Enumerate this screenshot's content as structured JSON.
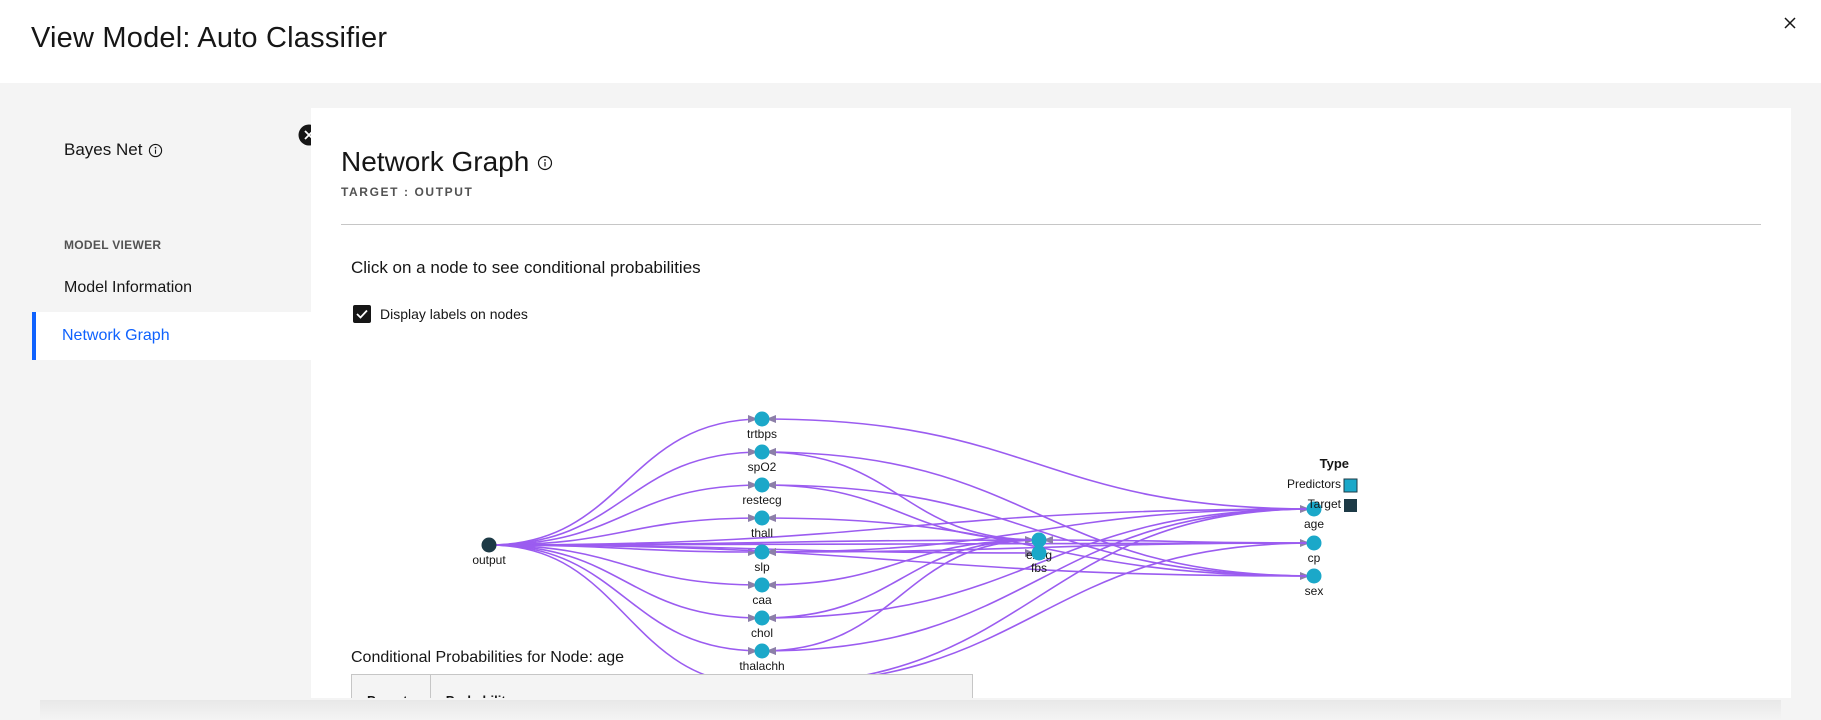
{
  "window": {
    "title": "View Model: Auto Classifier"
  },
  "sidebar": {
    "model_name": "Bayes Net",
    "section_label": "MODEL VIEWER",
    "items": [
      {
        "label": "Model Information"
      },
      {
        "label": "Network Graph"
      }
    ]
  },
  "main": {
    "title": "Network Graph",
    "target_label": "TARGET : OUTPUT",
    "instruction": "Click on a node to see conditional probabilities",
    "checkbox": {
      "label": "Display labels on nodes",
      "checked": true
    },
    "legend": {
      "title": "Type",
      "items": [
        {
          "label": "Predictors",
          "color": "#1ba8c9"
        },
        {
          "label": "Target",
          "color": "#1d3a46"
        }
      ]
    },
    "conditional": {
      "title": "Conditional Probabilities for Node: age",
      "headers": [
        "Parents",
        "Probability"
      ]
    }
  },
  "graph": {
    "edge_color": "#9b5cf0",
    "predictor_color": "#1ba8c9",
    "target_color": "#1d3a46",
    "nodes": [
      "output",
      "trtbps",
      "spO2",
      "restecg",
      "thall",
      "slp",
      "caa",
      "chol",
      "thalachh",
      "oldpeak",
      "exng",
      "fbs",
      "age",
      "cp",
      "sex"
    ]
  }
}
